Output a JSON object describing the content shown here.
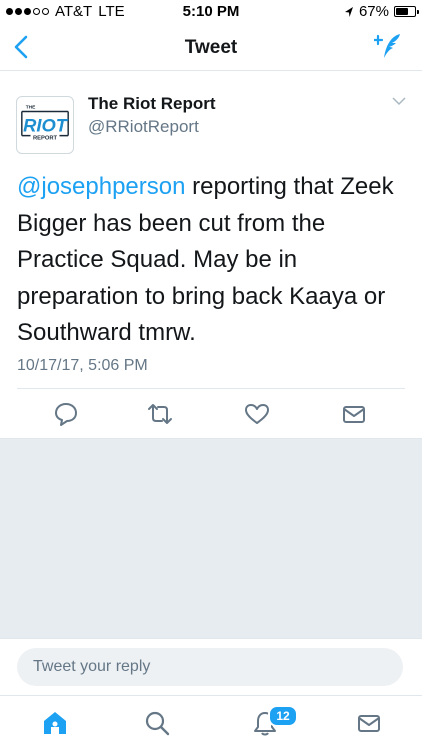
{
  "status_bar": {
    "carrier": "AT&T",
    "network": "LTE",
    "time": "5:10 PM",
    "battery": "67%",
    "battery_level": 0.67
  },
  "nav": {
    "title": "Tweet"
  },
  "tweet": {
    "author_name": "The Riot Report",
    "author_handle": "@RRiotReport",
    "avatar_text_top": "THE",
    "avatar_text_main": "RIOT",
    "avatar_text_bottom": "REPORT",
    "mention": "@josephperson",
    "text": " reporting that Zeek Bigger has been cut from the Practice Squad. May be in preparation to bring back Kaaya or Southward tmrw.",
    "timestamp": "10/17/17, 5:06 PM"
  },
  "reply": {
    "placeholder": "Tweet your reply"
  },
  "tabs": {
    "notifications_badge": "12"
  },
  "colors": {
    "accent": "#1da1f2",
    "text": "#14171a",
    "muted": "#657786"
  }
}
